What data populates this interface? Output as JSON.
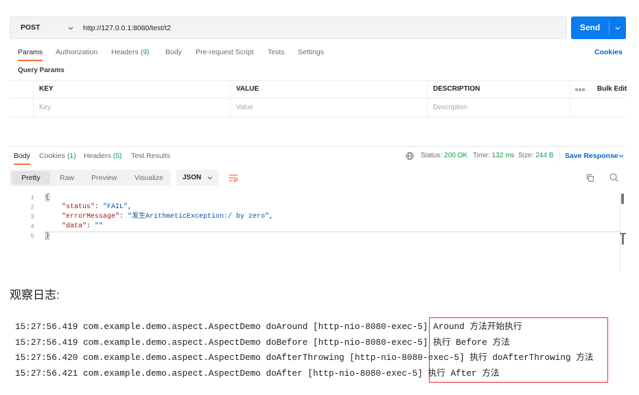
{
  "request": {
    "method": "POST",
    "url": "http://127.0.0.1:8080/test/t2",
    "send_label": "Send"
  },
  "request_tabs": [
    {
      "label": "Params",
      "active": true
    },
    {
      "label": "Authorization"
    },
    {
      "label": "Headers",
      "count": "(9)"
    },
    {
      "label": "Body"
    },
    {
      "label": "Pre-request Script"
    },
    {
      "label": "Tests"
    },
    {
      "label": "Settings"
    }
  ],
  "cookies_link": "Cookies",
  "query_params": {
    "title": "Query Params",
    "columns": [
      "KEY",
      "VALUE",
      "DESCRIPTION"
    ],
    "bulk_edit_label": "Bulk Edit",
    "placeholders": [
      "Key",
      "Value",
      "Description"
    ]
  },
  "response_tabs": [
    {
      "label": "Body",
      "active": true
    },
    {
      "label": "Cookies",
      "count": "(1)"
    },
    {
      "label": "Headers",
      "count": "(5)"
    },
    {
      "label": "Test Results"
    }
  ],
  "response_meta": {
    "status": {
      "label": "Status:",
      "value": "200 OK"
    },
    "time": {
      "label": "Time:",
      "value": "132 ms"
    },
    "size": {
      "label": "Size:",
      "value": "244 B"
    },
    "save_response_label": "Save Response"
  },
  "view_modes": [
    {
      "label": "Pretty",
      "active": true
    },
    {
      "label": "Raw"
    },
    {
      "label": "Preview"
    },
    {
      "label": "Visualize"
    }
  ],
  "format": "JSON",
  "response_body": [
    {
      "line": "1",
      "brace": "{"
    },
    {
      "line": "2",
      "key": "\"status\"",
      "colon": ": ",
      "value": "\"FAIL\"",
      "comma": ","
    },
    {
      "line": "3",
      "key": "\"errorMessage\"",
      "colon": ": ",
      "value": "\"发生ArithmeticException:/ by zero\"",
      "comma": ","
    },
    {
      "line": "4",
      "key": "\"data\"",
      "colon": ": ",
      "value": "\"\""
    },
    {
      "line": "5",
      "brace": "}"
    }
  ],
  "article": {
    "heading": "观察日志:",
    "log_lines": [
      "15:27:56.419 com.example.demo.aspect.AspectDemo doAround [http-nio-8080-exec-5] Around 方法开始执行",
      "15:27:56.419 com.example.demo.aspect.AspectDemo doBefore [http-nio-8080-exec-5] 执行 Before 方法",
      "15:27:56.420 com.example.demo.aspect.AspectDemo doAfterThrowing [http-nio-8080-exec-5] 执行 doAfterThrowing 方法",
      "15:27:56.421 com.example.demo.aspect.AspectDemo doAfter [http-nio-8080-exec-5] 执行 After 方法"
    ]
  },
  "icons": {
    "method_dropdown": "chevron-down-icon",
    "send_options": "chevron-down-icon",
    "row_options": "more-horizontal-icon",
    "network": "globe-icon",
    "save_response_menu": "chevron-down-icon",
    "format_dropdown": "chevron-down-icon",
    "wrap_lines": "wrap-lines-icon",
    "copy": "copy-icon",
    "search": "search-icon"
  },
  "colors": {
    "accent": "#ff6c37",
    "primary": "#097bed",
    "link": "#0b63ce",
    "success": "#0c9d4a",
    "json_key": "#a31515",
    "json_string": "#0451a5",
    "highlight_box": "#e02d2d"
  }
}
